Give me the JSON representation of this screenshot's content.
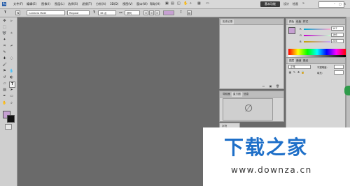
{
  "menu": {
    "items": [
      "文件(F)",
      "编辑(E)",
      "图像(I)",
      "图层(L)",
      "选择(S)",
      "滤镜(T)",
      "分析(A)",
      "3D(D)",
      "视图(V)",
      "窗口(W)",
      "帮助(H)"
    ]
  },
  "workspace": {
    "active": "基本功能",
    "links": [
      "设计",
      "绘画"
    ]
  },
  "options": {
    "tool_glyph": "T",
    "font_family": "Cambria Math",
    "font_style": "Regular",
    "font_size": "36 点",
    "anti_alias": "锐利",
    "text_color": "#c6a0d2"
  },
  "panels": {
    "history_tab": "历史记录",
    "color": {
      "tabs": [
        "颜色",
        "色板",
        "样式"
      ],
      "r_label": "R",
      "g_label": "G",
      "b_label": "B",
      "r_value": "197",
      "g_value": "166",
      "b_value": "206",
      "foreground": "#c6a0d2",
      "background": "#111111"
    },
    "layers": {
      "tabs": [
        "图层",
        "通道",
        "路径"
      ],
      "blend_mode": "正常",
      "opacity_label": "不透明度:",
      "fill_label": "填充:"
    },
    "navigator": {
      "tabs": [
        "导航器",
        "直方图",
        "信息"
      ]
    },
    "small_tab": "字符"
  },
  "watermark": {
    "title": "下载之家",
    "url": "www.downza.cn",
    "color": "#1e6fc8"
  }
}
